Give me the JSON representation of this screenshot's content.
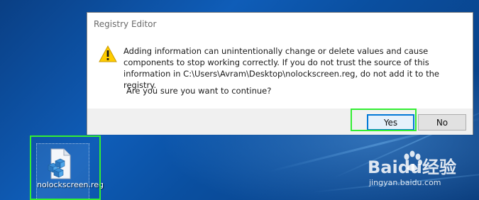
{
  "dialog": {
    "title": "Registry Editor",
    "message": "Adding information can unintentionally change or delete values and cause components to stop working correctly. If you do not trust the source of this information in C:\\Users\\Avram\\Desktop\\nolockscreen.reg, do not add it to the registry.",
    "question": "Are you sure you want to continue?",
    "yes_label": "Yes",
    "no_label": "No",
    "icon": "warning-icon"
  },
  "desktop": {
    "file_icon_label": "nolockscreen.reg",
    "file_icon": "registry-file-icon"
  },
  "watermark": {
    "brand": "Baidu经验",
    "url": "jingyan.baidu.com"
  },
  "colors": {
    "highlight": "#33ee33",
    "accent": "#0078d7",
    "warning": "#ffcc00"
  }
}
